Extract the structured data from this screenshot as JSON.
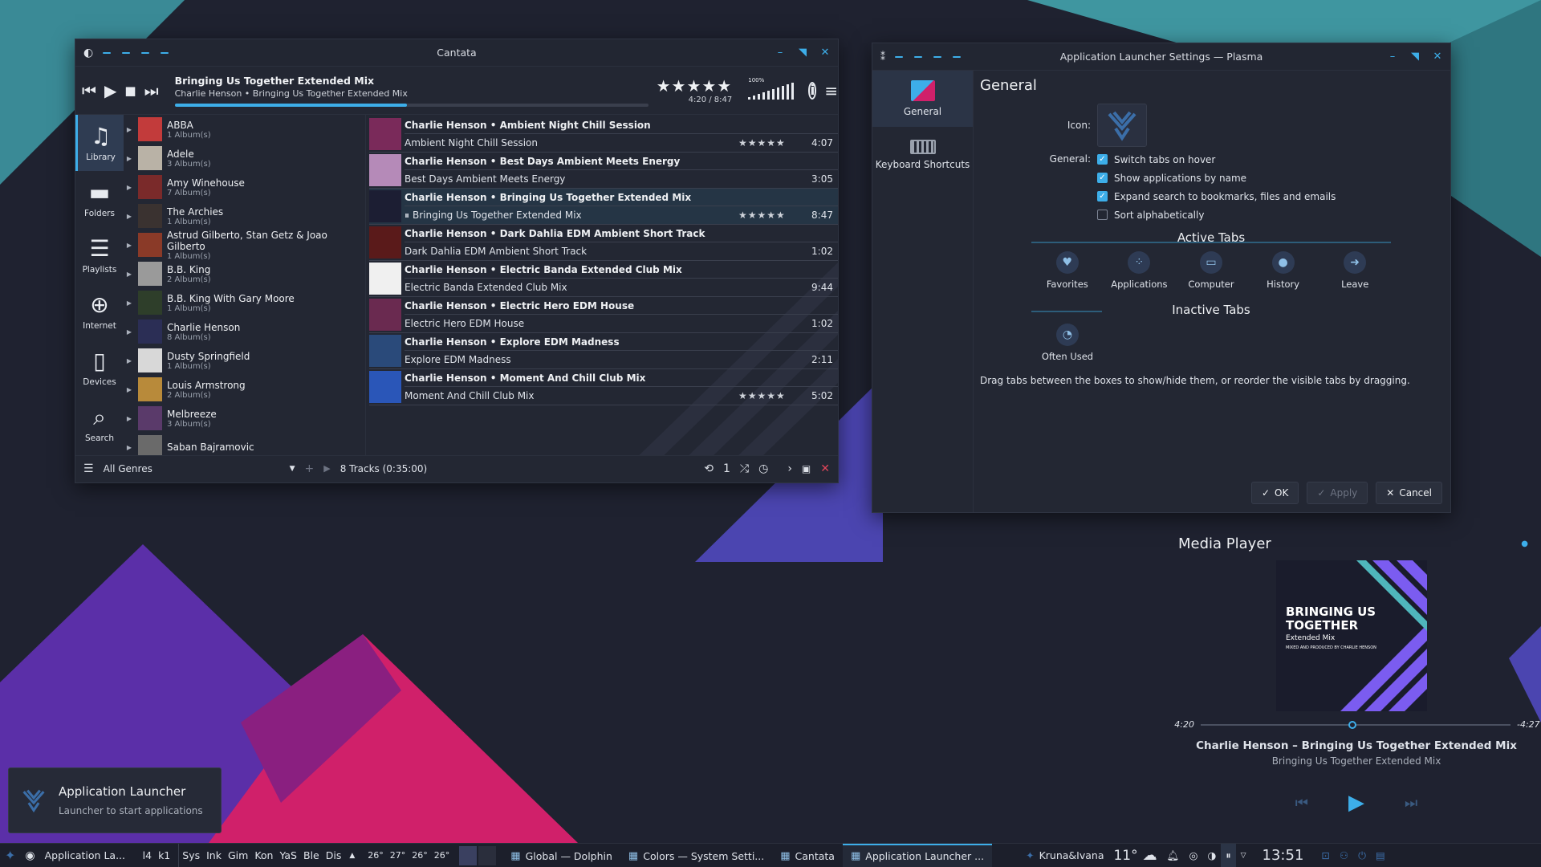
{
  "cantata": {
    "window_title": "Cantata",
    "now_playing": {
      "title": "Bringing Us Together Extended Mix",
      "subtitle": "Charlie Henson • Bringing Us Together Extended Mix",
      "rating": "★★★★★",
      "time": "4:20 / 8:47",
      "progress": 0.49,
      "volume_label": "100%"
    },
    "sidebar": [
      {
        "label": "Library",
        "icon": "music-note-icon",
        "glyph": "♫"
      },
      {
        "label": "Folders",
        "icon": "folder-icon",
        "glyph": "▬"
      },
      {
        "label": "Playlists",
        "icon": "playlist-icon",
        "glyph": "☰"
      },
      {
        "label": "Internet",
        "icon": "globe-icon",
        "glyph": "⊕"
      },
      {
        "label": "Devices",
        "icon": "device-icon",
        "glyph": "▯"
      },
      {
        "label": "Search",
        "icon": "search-icon",
        "glyph": "⌕"
      }
    ],
    "artists": [
      {
        "name": "ABBA",
        "count": "1 Album(s)",
        "color": "#c23b3b"
      },
      {
        "name": "Adele",
        "count": "3 Album(s)",
        "color": "#b9b2a6"
      },
      {
        "name": "Amy Winehouse",
        "count": "7 Album(s)",
        "color": "#7a2a2a"
      },
      {
        "name": "The Archies",
        "count": "1 Album(s)",
        "color": "#3a3230"
      },
      {
        "name": "Astrud Gilberto, Stan Getz & Joao Gilberto",
        "count": "1 Album(s)",
        "color": "#8a3a28"
      },
      {
        "name": "B.B. King",
        "count": "2 Album(s)",
        "color": "#9a9a9a"
      },
      {
        "name": "B.B. King With Gary Moore",
        "count": "1 Album(s)",
        "color": "#2e3e2a"
      },
      {
        "name": "Charlie Henson",
        "count": "8 Album(s)",
        "color": "#2b2e55"
      },
      {
        "name": "Dusty Springfield",
        "count": "1 Album(s)",
        "color": "#d8d8d8"
      },
      {
        "name": "Louis Armstrong",
        "count": "2 Album(s)",
        "color": "#b88a3a"
      },
      {
        "name": "Melbreeze",
        "count": "3 Album(s)",
        "color": "#5a3a6a"
      },
      {
        "name": "Saban Bajramovic",
        "count": "",
        "color": "#6a6a6a"
      }
    ],
    "tracks": [
      {
        "header": "Charlie Henson • Ambient Night Chill Session",
        "name": "Ambient Night Chill Session",
        "rating": "★★★★★",
        "duration": "4:07",
        "color": "#7a2a5a"
      },
      {
        "header": "Charlie Henson • Best Days Ambient Meets Energy",
        "name": "Best Days Ambient Meets Energy",
        "rating": "",
        "duration": "3:05",
        "color": "#b58ab8"
      },
      {
        "header": "Charlie Henson • Bringing Us Together Extended Mix",
        "name": "Bringing Us Together Extended Mix",
        "rating": "★★★★★",
        "duration": "8:47",
        "color": "#1c1e33",
        "playing": true
      },
      {
        "header": "Charlie Henson • Dark Dahlia EDM Ambient Short Track",
        "name": "Dark Dahlia EDM Ambient Short Track",
        "rating": "",
        "duration": "1:02",
        "color": "#5a1a1a"
      },
      {
        "header": "Charlie Henson • Electric Banda Extended Club Mix",
        "name": "Electric Banda Extended Club Mix",
        "rating": "",
        "duration": "9:44",
        "color": "#f0f0f0"
      },
      {
        "header": "Charlie Henson • Electric Hero EDM House",
        "name": "Electric Hero EDM House",
        "rating": "",
        "duration": "1:02",
        "color": "#6a2a50"
      },
      {
        "header": "Charlie Henson • Explore EDM Madness",
        "name": "Explore EDM Madness",
        "rating": "",
        "duration": "2:11",
        "color": "#2a4a7a"
      },
      {
        "header": "Charlie Henson • Moment And Chill Club Mix",
        "name": "Moment And Chill Club Mix",
        "rating": "★★★★★",
        "duration": "5:02",
        "color": "#2a56b8"
      }
    ],
    "bottom": {
      "genre": "All Genres",
      "summary": "8 Tracks (0:35:00)",
      "single": "1"
    }
  },
  "settings": {
    "window_title": "Application Launcher Settings — Plasma",
    "sidebar": [
      {
        "label": "General",
        "icon": "general-icon"
      },
      {
        "label": "Keyboard Shortcuts",
        "icon": "keyboard-icon"
      }
    ],
    "heading": "General",
    "icon_label": "Icon:",
    "general_label": "General:",
    "options": [
      {
        "label": "Switch tabs on hover",
        "checked": true
      },
      {
        "label": "Show applications by name",
        "checked": true
      },
      {
        "label": "Expand search to bookmarks, files and emails",
        "checked": true
      },
      {
        "label": "Sort alphabetically",
        "checked": false
      }
    ],
    "active_tabs_title": "Active Tabs",
    "active_tabs": [
      {
        "label": "Favorites",
        "icon": "heart-icon",
        "glyph": "♥"
      },
      {
        "label": "Applications",
        "icon": "apps-icon",
        "glyph": "⁘"
      },
      {
        "label": "Computer",
        "icon": "monitor-icon",
        "glyph": "▭"
      },
      {
        "label": "History",
        "icon": "history-icon",
        "glyph": "●"
      },
      {
        "label": "Leave",
        "icon": "leave-icon",
        "glyph": "➜"
      }
    ],
    "inactive_tabs_title": "Inactive Tabs",
    "inactive_tabs": [
      {
        "label": "Often Used",
        "icon": "pie-icon",
        "glyph": "◔"
      }
    ],
    "hint": "Drag tabs between the boxes to show/hide them, or reorder the visible tabs by dragging.",
    "buttons": {
      "ok": "OK",
      "apply": "Apply",
      "cancel": "Cancel"
    }
  },
  "media_player": {
    "title": "Media Player",
    "cover_title": "BRINGING US TOGETHER",
    "cover_sub": "Extended Mix",
    "cover_credit": "MIXED AND PRODUCED BY CHARLIE HENSON",
    "elapsed": "4:20",
    "remaining": "-4:27",
    "position": 0.49,
    "track": "Charlie Henson – Bringing Us Together Extended Mix",
    "album": "Bringing Us Together Extended Mix"
  },
  "notification": {
    "title": "Application Launcher",
    "body": "Launcher to start applications"
  },
  "taskbar": {
    "launcher_label": "Application La...",
    "quick": [
      "l4",
      "k1"
    ],
    "pinned": [
      "Sys",
      "Ink",
      "Gim",
      "Kon",
      "YaS",
      "Ble",
      "Dis"
    ],
    "temps": [
      "26°",
      "27°",
      "26°",
      "26°"
    ],
    "tasks": [
      {
        "label": "Global — Dolphin",
        "icon": "folder-icon"
      },
      {
        "label": "Colors — System Setti...",
        "icon": "settings-icon"
      },
      {
        "label": "Cantata",
        "icon": "cantata-icon"
      },
      {
        "label": "Application Launcher ...",
        "icon": "launcher-icon",
        "active": true
      }
    ],
    "user": "Kruna&Ivana",
    "weather": "11°",
    "clock": "13:51"
  },
  "colors": {
    "accent": "#3daee9",
    "bg": "#1f2230"
  }
}
